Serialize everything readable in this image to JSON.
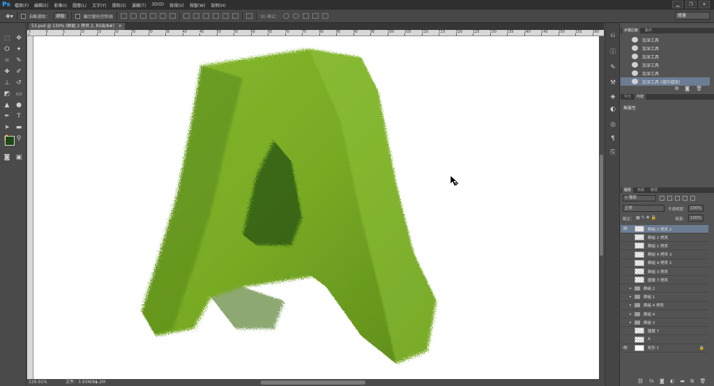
{
  "app": {
    "logo": "Ps"
  },
  "menu": [
    "檔案(F)",
    "編輯(E)",
    "影像(I)",
    "圖層(L)",
    "文字(Y)",
    "選取(S)",
    "濾鏡(T)",
    "3D(D)",
    "檢視(V)",
    "視窗(W)",
    "說明(H)"
  ],
  "options_bar": {
    "auto_select_label": "自動選取：",
    "auto_select_value": "群組",
    "transform_controls_label": "顯示變形控制項",
    "mode_3d_label": "3D 模式：",
    "workspace": "繪畫"
  },
  "document": {
    "tab_title": "53.psd @ 130% (群組 2 拷貝 2, RGB/8#)",
    "zoom": "129.91%",
    "doc_info": "文件：3.93M/81.2M"
  },
  "history_panel": {
    "tabs": [
      "步驟記錄",
      "動作"
    ],
    "items": [
      "加深工具",
      "加深工具",
      "加深工具",
      "加深工具",
      "加深工具",
      "加深工具 (儲存檔案)"
    ],
    "selected_index": 5
  },
  "properties_panel": {
    "tabs": [
      "字元",
      "內容"
    ],
    "empty_text": "無屬性"
  },
  "layers_panel": {
    "tabs": [
      "圖層",
      "色版",
      "路徑"
    ],
    "filter_kind": "種類",
    "blend_mode": "正常",
    "opacity_label": "不透明度：",
    "opacity_value": "100%",
    "lock_label": "鎖定：",
    "fill_label": "填滿：",
    "fill_value": "100%",
    "layers": [
      {
        "name": "群組 2 拷貝 2",
        "kind": "pixel",
        "visible": true,
        "selected": true
      },
      {
        "name": "群組 2 拷貝",
        "kind": "pixel",
        "visible": false
      },
      {
        "name": "群組 1 拷貝",
        "kind": "pixel",
        "visible": false
      },
      {
        "name": "群組 4 拷貝 3",
        "kind": "pixel",
        "visible": false
      },
      {
        "name": "群組 4 拷貝 2",
        "kind": "pixel",
        "visible": false
      },
      {
        "name": "群組 3 拷貝",
        "kind": "pixel",
        "visible": false
      },
      {
        "name": "圖層 7 拷貝",
        "kind": "pixel",
        "visible": false
      },
      {
        "name": "群組 2",
        "kind": "group",
        "visible": false
      },
      {
        "name": "群組 1",
        "kind": "group",
        "visible": false
      },
      {
        "name": "群組 4 拷貝",
        "kind": "group",
        "visible": false
      },
      {
        "name": "群組 4",
        "kind": "group",
        "visible": false
      },
      {
        "name": "群組 3",
        "kind": "group",
        "visible": false
      },
      {
        "name": "圖層 7",
        "kind": "pixel",
        "visible": false
      },
      {
        "name": "A",
        "kind": "smart",
        "visible": false
      },
      {
        "name": "矩形 1",
        "kind": "shape",
        "visible": true,
        "locked": true
      }
    ]
  },
  "ruler_ticks": [
    "5",
    "0",
    "5",
    "10",
    "15",
    "20",
    "25",
    "30",
    "35",
    "40",
    "45",
    "50",
    "55",
    "60",
    "65",
    "70",
    "75",
    "80",
    "85",
    "90",
    "95",
    "100",
    "105",
    "110",
    "115",
    "120",
    "125",
    "130",
    "135",
    "140",
    "145",
    "150",
    "155",
    "160",
    "165"
  ],
  "colors": {
    "foreground": "#1f4a12",
    "background": "#5e8f22",
    "accent_selection": "#6b7c93",
    "grass": "#7fb22a"
  }
}
